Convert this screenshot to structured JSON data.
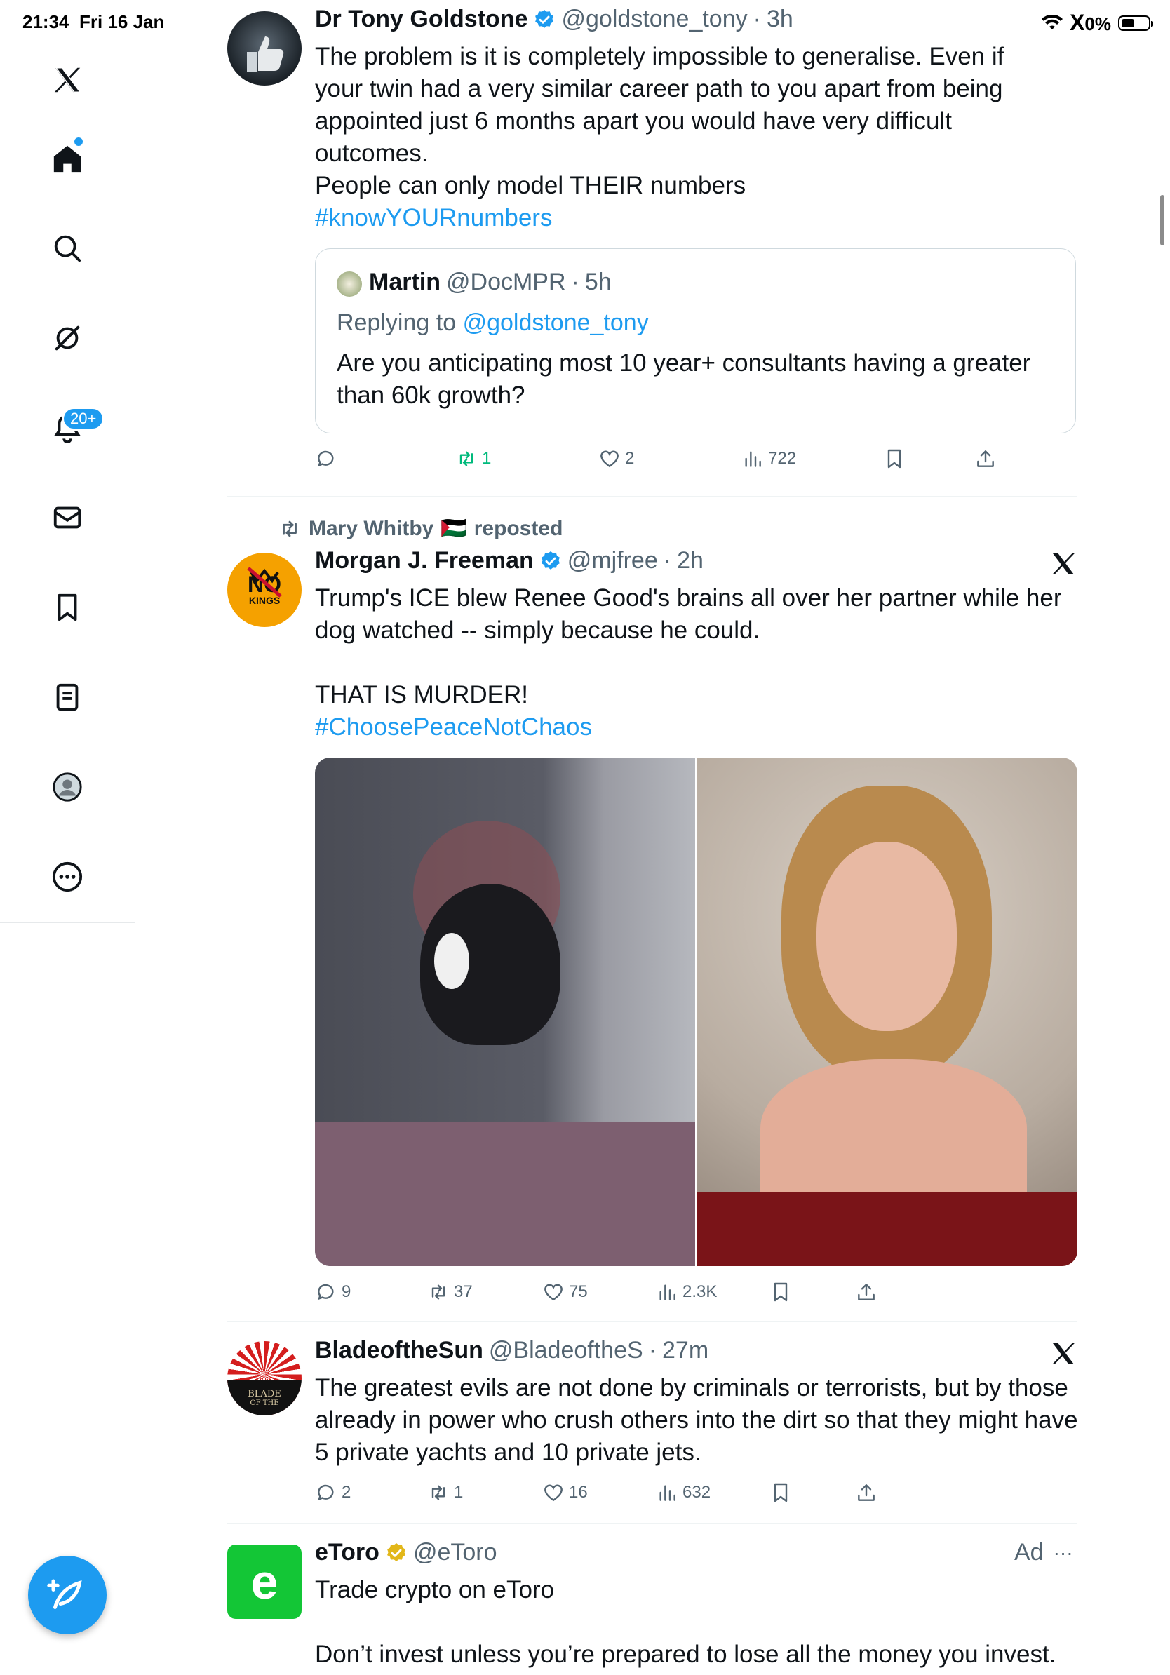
{
  "status_bar": {
    "time": "21:34",
    "date": "Fri 16 Jan",
    "battery": "0%",
    "battery_glyph": "X"
  },
  "sidebar": {
    "notifications_badge": "20+"
  },
  "colors": {
    "accent": "#1d9bf0",
    "retweet_green": "#00ba7c",
    "text_secondary": "#536471",
    "etoro_green": "#13c636",
    "gold_badge": "#e2b719"
  },
  "tweets": [
    {
      "name": "Dr Tony Goldstone",
      "handle": "@goldstone_tony",
      "dot": "·",
      "time": "3h",
      "text_1": "The problem is it is completely impossible to generalise. Even if your twin had a very similar career path to you apart from being appointed just 6 months apart you would have very difficult outcomes.",
      "text_2": "People can only model THEIR numbers",
      "hashtag": "#knowYOURnumbers",
      "quote": {
        "name": "Martin",
        "handle": "@DocMPR",
        "dot": "·",
        "time": "5h",
        "replying_prefix": "Replying to",
        "replying_to": "@goldstone_tony",
        "text": "Are you anticipating most 10 year+ consultants having a greater than 60k growth?"
      },
      "stats": {
        "replies": "",
        "retweets": "1",
        "likes": "2",
        "views": "722"
      }
    },
    {
      "repost_by": "Mary Whitby",
      "repost_flag": "🇵🇸",
      "repost_suffix": "reposted",
      "name": "Morgan J. Freeman",
      "handle": "@mjfree",
      "dot": "·",
      "time": "2h",
      "avatar_text_1": "NO",
      "avatar_text_2": "KINGS",
      "text_1": "Trump's ICE blew Renee Good's brains all over her partner while her dog watched -- simply because he could.",
      "text_2": "THAT IS MURDER!",
      "hashtag": "#ChoosePeaceNotChaos",
      "stats": {
        "replies": "9",
        "retweets": "37",
        "likes": "75",
        "views": "2.3K"
      }
    },
    {
      "name": "BladeoftheSun",
      "handle": "@BladeoftheS",
      "dot": "·",
      "time": "27m",
      "avatar_text_1": "BLADE",
      "avatar_text_2": "OF THE",
      "text_1": "The greatest evils are not done by criminals or terrorists, but by those already in power who crush others into the dirt so that they might have 5 private yachts and 10 private jets.",
      "stats": {
        "replies": "2",
        "retweets": "1",
        "likes": "16",
        "views": "632"
      }
    },
    {
      "name": "eToro",
      "handle": "@eToro",
      "ad_label": "Ad",
      "more": "···",
      "avatar_text": "e",
      "text_1": "Trade crypto on eToro",
      "text_2": "Don’t invest unless you’re prepared to lose all the money you invest."
    }
  ]
}
